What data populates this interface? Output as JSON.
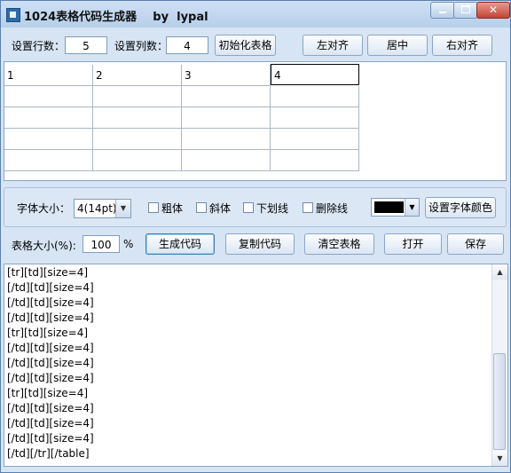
{
  "window": {
    "title": "1024表格代码生成器    by  lypal",
    "controls": {
      "minimize": "",
      "maximize": "",
      "close": "✕"
    }
  },
  "setup": {
    "rows_label": "设置行数：",
    "rows_value": "5",
    "cols_label": "设置列数：",
    "cols_value": "4",
    "init_button": "初始化表格",
    "align_left": "左对齐",
    "align_center": "居中",
    "align_right": "右对齐"
  },
  "grid": {
    "rows": [
      [
        "1",
        "2",
        "3",
        "4"
      ],
      [
        "",
        "",
        "",
        ""
      ],
      [
        "",
        "",
        "",
        ""
      ],
      [
        "",
        "",
        "",
        ""
      ],
      [
        "",
        "",
        "",
        ""
      ]
    ]
  },
  "font": {
    "size_label": "字体大小：",
    "size_value": "4(14pt)",
    "bold": "粗体",
    "italic": "斜体",
    "underline": "下划线",
    "strike": "删除线",
    "color_value": "#000000",
    "color_button": "设置字体颜色"
  },
  "actions": {
    "table_size_label": "表格大小(%):",
    "table_size_value": "100",
    "percent": "%",
    "generate": "生成代码",
    "copy": "复制代码",
    "clear": "清空表格",
    "open": "打开",
    "save": "保存"
  },
  "output_lines": [
    "[tr][td][size=4]",
    "[/td][td][size=4]",
    "[/td][td][size=4]",
    "[/td][td][size=4]",
    "[tr][td][size=4]",
    "[/td][td][size=4]",
    "[/td][td][size=4]",
    "[/td][td][size=4]",
    "[tr][td][size=4]",
    "[/td][td][size=4]",
    "[/td][td][size=4]",
    "[/td][td][size=4]",
    "[/td][/tr][/table]"
  ],
  "icons": {
    "app": "app-icon",
    "dropdown": "▼",
    "scroll_up": "▲",
    "scroll_down": "▼"
  }
}
